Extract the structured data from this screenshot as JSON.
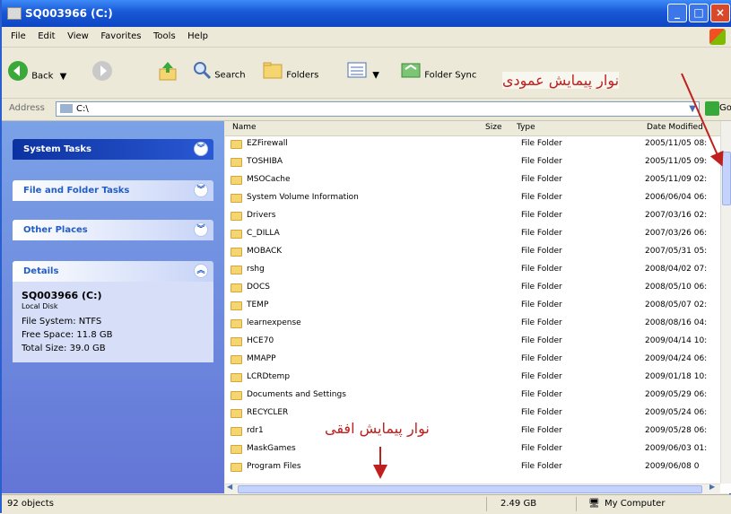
{
  "window": {
    "title": "SQ003966 (C:)",
    "controls": {
      "min": "_",
      "max": "□",
      "close": "×"
    }
  },
  "menu": [
    "File",
    "Edit",
    "View",
    "Favorites",
    "Tools",
    "Help"
  ],
  "toolbar": {
    "back": "Back",
    "search": "Search",
    "folders": "Folders",
    "folder_sync": "Folder Sync"
  },
  "address": {
    "label": "Address",
    "value": "C:\\",
    "go": "Go"
  },
  "left_pane": {
    "system_tasks": "System Tasks",
    "file_folder_tasks": "File and Folder Tasks",
    "other_places": "Other Places",
    "details": {
      "header": "Details",
      "name": "SQ003966 (C:)",
      "subtitle": "Local Disk",
      "file_system": "File System: NTFS",
      "free_space": "Free Space: 11.8 GB",
      "total_size": "Total Size: 39.0 GB"
    }
  },
  "columns": {
    "name": "Name",
    "size": "Size",
    "type": "Type",
    "date": "Date Modified"
  },
  "files": [
    {
      "name": "EZFirewall",
      "type": "File Folder",
      "date": "2005/11/05 08:"
    },
    {
      "name": "TOSHIBA",
      "type": "File Folder",
      "date": "2005/11/05 09:"
    },
    {
      "name": "MSOCache",
      "type": "File Folder",
      "date": "2005/11/09 02:"
    },
    {
      "name": "System Volume Information",
      "type": "File Folder",
      "date": "2006/06/04 06:"
    },
    {
      "name": "Drivers",
      "type": "File Folder",
      "date": "2007/03/16 02:"
    },
    {
      "name": "C_DILLA",
      "type": "File Folder",
      "date": "2007/03/26 06:"
    },
    {
      "name": "MOBACK",
      "type": "File Folder",
      "date": "2007/05/31 05:"
    },
    {
      "name": "rshg",
      "type": "File Folder",
      "date": "2008/04/02 07:"
    },
    {
      "name": "DOCS",
      "type": "File Folder",
      "date": "2008/05/10 06:"
    },
    {
      "name": "TEMP",
      "type": "File Folder",
      "date": "2008/05/07 02:"
    },
    {
      "name": "learnexpense",
      "type": "File Folder",
      "date": "2008/08/16 04:"
    },
    {
      "name": "HCE70",
      "type": "File Folder",
      "date": "2009/04/14 10:"
    },
    {
      "name": "MMAPP",
      "type": "File Folder",
      "date": "2009/04/24 06:"
    },
    {
      "name": "LCRDtemp",
      "type": "File Folder",
      "date": "2009/01/18 10:"
    },
    {
      "name": "Documents and Settings",
      "type": "File Folder",
      "date": "2009/05/29 06:"
    },
    {
      "name": "RECYCLER",
      "type": "File Folder",
      "date": "2009/05/24 06:"
    },
    {
      "name": "rdr1",
      "type": "File Folder",
      "date": "2009/05/28 06:"
    },
    {
      "name": "MaskGames",
      "type": "File Folder",
      "date": "2009/06/03 01:"
    },
    {
      "name": "Program Files",
      "type": "File Folder",
      "date": "2009/06/08 0"
    }
  ],
  "status": {
    "objects": "92 objects",
    "size": "2.49 GB",
    "location": "My Computer"
  },
  "annotations": {
    "vertical": "نوار پیمایش عمودی",
    "horizontal": "نوار پیمایش افقی"
  },
  "colors": {
    "title_blue": "#1857d6",
    "annotation_red": "#c0201d",
    "task_pane": "#7ba2e7"
  }
}
